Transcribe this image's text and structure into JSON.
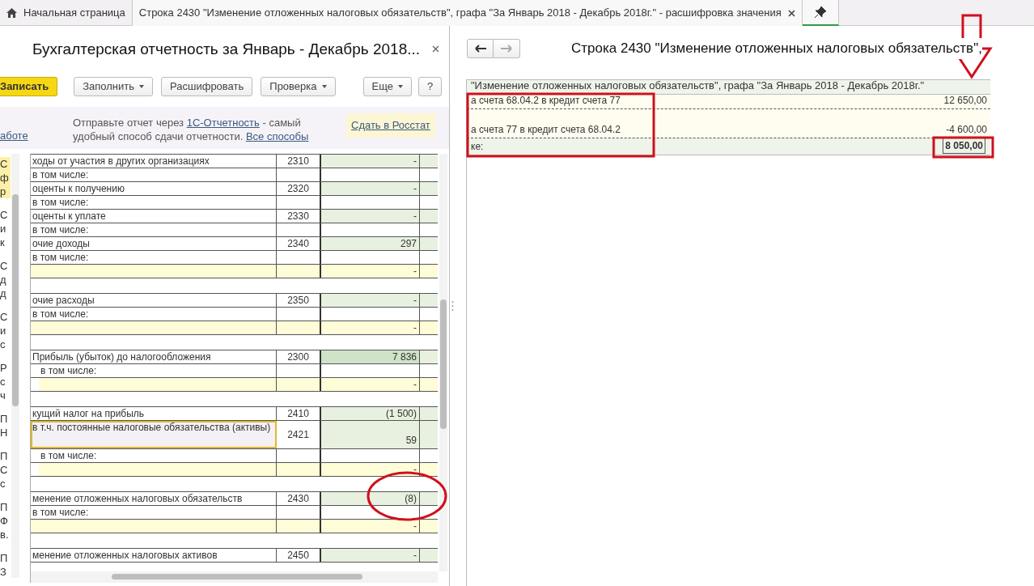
{
  "tabs": [
    {
      "label": "Начальная страница",
      "kind": "home",
      "selected": false,
      "closable": false
    },
    {
      "label": "Строка 2430 \"Изменение отложенных налоговых обязательств\", графа \"За Январь 2018 - Декабрь 2018г.\" - расшифровка значения",
      "kind": "doc",
      "selected": true,
      "closable": true
    }
  ],
  "pin_button": {
    "on": true
  },
  "report": {
    "title": "Бухгалтерская отчетность за Январь - Декабрь 2018...",
    "toolbar": [
      {
        "label": "Записать",
        "kind": "primary",
        "dropdown": false
      },
      {
        "label": "Заполнить",
        "kind": "normal",
        "dropdown": true
      },
      {
        "label": "Расшифровать",
        "kind": "normal",
        "dropdown": false
      },
      {
        "label": "Проверка",
        "kind": "normal",
        "dropdown": true
      },
      {
        "label": "Еще",
        "kind": "more",
        "dropdown": true
      },
      {
        "label": "?",
        "kind": "help",
        "dropdown": false
      }
    ],
    "side_link": "аботе",
    "notice": {
      "before": "Отправьте отчет через ",
      "link": "1С-Отчетность",
      "middle": " - самый удобный способ сдачи отчетности. ",
      "link2": "Все способы"
    },
    "rosstat_button": "Сдать в Росстат",
    "sidebar": [
      {
        "lines": [
          "С",
          "ф",
          "р"
        ],
        "selected": true
      },
      {
        "lines": [
          "С",
          "и",
          "к"
        ],
        "selected": false
      },
      {
        "lines": [
          "С",
          "д",
          "д"
        ],
        "selected": false
      },
      {
        "lines": [
          "С",
          "и",
          "с"
        ],
        "selected": false
      },
      {
        "lines": [
          "Р",
          "с",
          "ч"
        ],
        "selected": false
      },
      {
        "lines": [
          "П",
          "Н"
        ],
        "selected": false
      },
      {
        "lines": [
          "П",
          "С",
          "с"
        ],
        "selected": false
      },
      {
        "lines": [
          "П",
          "Ф",
          "в."
        ],
        "selected": false
      },
      {
        "lines": [
          "П",
          "З"
        ],
        "selected": false
      }
    ],
    "rows": [
      {
        "kind": "line",
        "label": "ходы от участия в других организациях",
        "code": "2310",
        "value": "-",
        "emphasis": false,
        "selected": false
      },
      {
        "kind": "sub",
        "label": "в том числе:",
        "indented": false
      },
      {
        "kind": "line",
        "label": "оценты к получению",
        "code": "2320",
        "value": "-",
        "emphasis": false,
        "selected": false
      },
      {
        "kind": "sub",
        "label": "в том числе:",
        "indented": false
      },
      {
        "kind": "line",
        "label": "оценты к уплате",
        "code": "2330",
        "value": "-",
        "emphasis": false,
        "selected": false
      },
      {
        "kind": "sub",
        "label": "в том числе:",
        "indented": false
      },
      {
        "kind": "line",
        "label": "очие доходы",
        "code": "2340",
        "value": "297",
        "emphasis": false,
        "selected": false
      },
      {
        "kind": "sub",
        "label": "в том числе:",
        "indented": false
      },
      {
        "kind": "detail",
        "value": "-",
        "indented": false
      },
      {
        "kind": "gap"
      },
      {
        "kind": "line",
        "label": "очие расходы",
        "code": "2350",
        "value": "-",
        "emphasis": false,
        "selected": false
      },
      {
        "kind": "sub",
        "label": "в том числе:",
        "indented": false
      },
      {
        "kind": "detail",
        "value": "-",
        "indented": false
      },
      {
        "kind": "gap"
      },
      {
        "kind": "line",
        "label": "Прибыль (убыток) до налогообложения",
        "code": "2300",
        "value": "7 836",
        "emphasis": true,
        "selected": false
      },
      {
        "kind": "sub",
        "label": "в том числе:",
        "indented": true
      },
      {
        "kind": "detail",
        "value": "-",
        "indented": true
      },
      {
        "kind": "gap"
      },
      {
        "kind": "line",
        "label": "кущий налог на прибыль",
        "code": "2410",
        "value": "(1 500)",
        "emphasis": false,
        "selected": false
      },
      {
        "kind": "line",
        "label": "в т.ч. постоянные налоговые обязательства (активы)",
        "code": "2421",
        "value": "59",
        "emphasis": false,
        "selected": true
      },
      {
        "kind": "sub",
        "label": "в том числе:",
        "indented": true
      },
      {
        "kind": "detail",
        "value": "-",
        "indented": true
      },
      {
        "kind": "gap"
      },
      {
        "kind": "line",
        "label": "менение отложенных налоговых обязательств",
        "code": "2430",
        "value": "(8)",
        "emphasis": false,
        "selected": false
      },
      {
        "kind": "sub",
        "label": "в том числе:",
        "indented": false
      },
      {
        "kind": "detail",
        "value": "-",
        "indented": false
      },
      {
        "kind": "gap"
      },
      {
        "kind": "line",
        "label": "менение отложенных налоговых активов",
        "code": "2450",
        "value": "-",
        "emphasis": false,
        "selected": false
      }
    ]
  },
  "breakdown": {
    "title": "Строка 2430 \"Изменение отложенных налоговых обязательств\",",
    "rows": [
      {
        "kind": "header",
        "label": "\"Изменение отложенных налоговых обязательств\", графа \"За Январь 2018 - Декабрь 2018г.\""
      },
      {
        "kind": "row",
        "label": "а счета 68.04.2 в кредит счета 77",
        "value": "12 650,00"
      },
      {
        "kind": "blank"
      },
      {
        "kind": "row",
        "label": "а счета 77 в кредит счета 68.04.2",
        "value": "-4 600,00"
      },
      {
        "kind": "total",
        "label": "ке:",
        "value": "8 050,00"
      }
    ]
  }
}
